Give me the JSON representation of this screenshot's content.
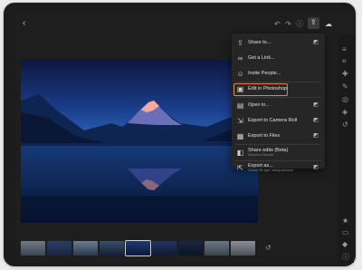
{
  "toolbar": {
    "back_icon": "chevron-left-icon",
    "icons": [
      "undo-icon",
      "redo-icon",
      "info-icon",
      "cloud-icon",
      "share-icon",
      "sync-cloud-icon"
    ]
  },
  "share_menu": {
    "items": [
      {
        "label": "Share to...",
        "icon": "share-icon",
        "right": "pro"
      },
      {
        "label": "Get a Link...",
        "icon": "link-icon",
        "right": ""
      },
      {
        "label": "Invite People...",
        "icon": "invite-icon",
        "right": ""
      },
      {
        "label": "Edit in Photoshop",
        "icon": "photoshop-icon",
        "right": "",
        "highlighted": true
      },
      {
        "label": "Open in...",
        "icon": "open-in-icon",
        "right": "pro"
      },
      {
        "label": "Export to Camera Roll",
        "icon": "export-icon",
        "right": "pro"
      },
      {
        "label": "Export to Files",
        "icon": "files-icon",
        "right": "pro"
      },
      {
        "label": "Share edits (Beta)",
        "sub": "Submit to Discover",
        "icon": "share-edits-icon",
        "right": ""
      },
      {
        "label": "Export as...",
        "sub": "Choose file type, sizing and more",
        "icon": "export-as-icon",
        "right": "pro"
      }
    ]
  },
  "sidebar_icons": [
    "sliders-icon",
    "crop-icon",
    "heal-icon",
    "brush-icon",
    "profile-icon",
    "presets-icon",
    "versions-icon",
    "star-icon",
    "comment-icon",
    "tag-icon",
    "info-icon"
  ],
  "colors": {
    "highlight": "#e8872c",
    "menu_bg": "#262626",
    "app_bg": "#1e1e1e"
  }
}
